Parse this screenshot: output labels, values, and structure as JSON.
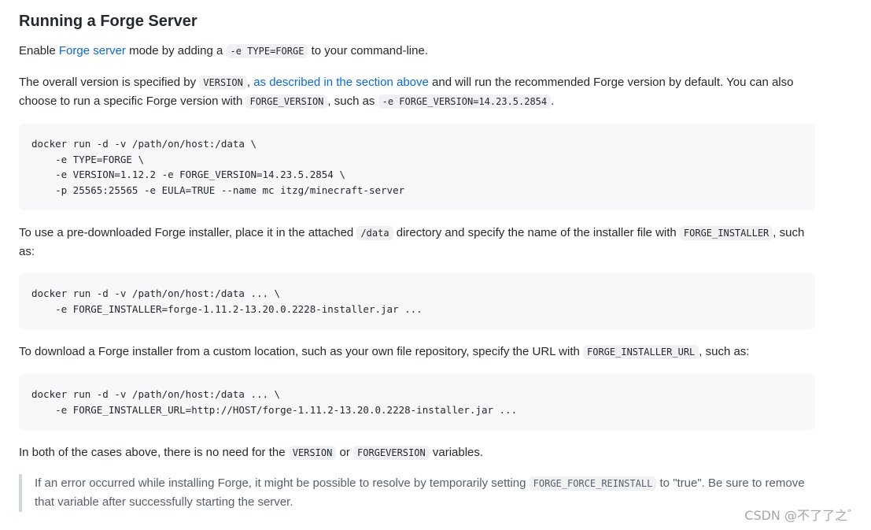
{
  "heading": "Running a Forge Server",
  "p1": {
    "t1": "Enable ",
    "link": "Forge server",
    "t2": " mode by adding a ",
    "code": "-e TYPE=FORGE",
    "t3": " to your command-line."
  },
  "p2": {
    "t1": "The overall version is specified by ",
    "code1": "VERSION",
    "t2": ", ",
    "link": "as described in the section above",
    "t3": " and will run the recommended Forge version by default. You can also choose to run a specific Forge version with ",
    "code2": "FORGE_VERSION",
    "t4": ", such as ",
    "code3": "-e FORGE_VERSION=14.23.5.2854",
    "t5": "."
  },
  "code_block_1": "docker run -d -v /path/on/host:/data \\\n    -e TYPE=FORGE \\\n    -e VERSION=1.12.2 -e FORGE_VERSION=14.23.5.2854 \\\n    -p 25565:25565 -e EULA=TRUE --name mc itzg/minecraft-server",
  "p3": {
    "t1": "To use a pre-downloaded Forge installer, place it in the attached ",
    "code1": "/data",
    "t2": " directory and specify the name of the installer file with ",
    "code2": "FORGE_INSTALLER",
    "t3": ", such as:"
  },
  "code_block_2": "docker run -d -v /path/on/host:/data ... \\\n    -e FORGE_INSTALLER=forge-1.11.2-13.20.0.2228-installer.jar ...",
  "p4": {
    "t1": "To download a Forge installer from a custom location, such as your own file repository, specify the URL with ",
    "code": "FORGE_INSTALLER_URL",
    "t2": ", such as:"
  },
  "code_block_3": "docker run -d -v /path/on/host:/data ... \\\n    -e FORGE_INSTALLER_URL=http://HOST/forge-1.11.2-13.20.0.2228-installer.jar ...",
  "p5": {
    "t1": "In both of the cases above, there is no need for the ",
    "code1": "VERSION",
    "t2": " or ",
    "code2": "FORGEVERSION",
    "t3": " variables."
  },
  "note": {
    "t1": "If an error occurred while installing Forge, it might be possible to resolve by temporarily setting ",
    "code": "FORGE_FORCE_REINSTALL",
    "t2": " to \"true\". Be sure to remove that variable after successfully starting the server."
  },
  "watermark": "CSDN @不了了之゛"
}
